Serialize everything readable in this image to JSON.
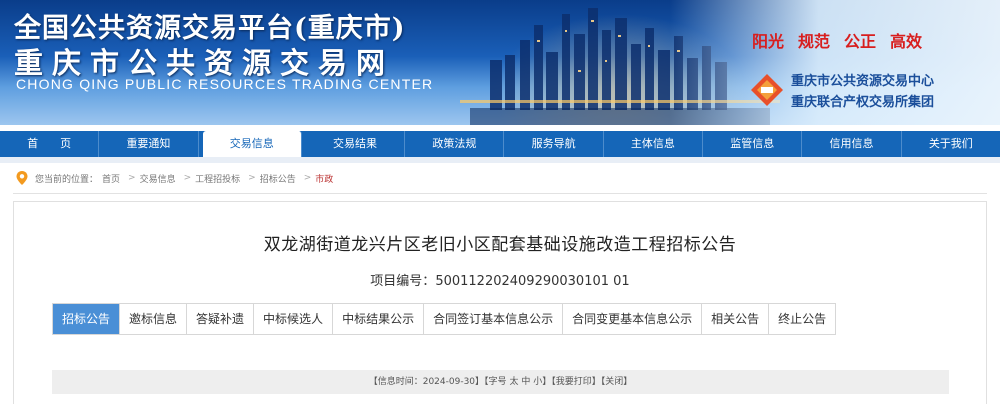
{
  "header": {
    "title_main": "全国公共资源交易平台(重庆市)",
    "title_sub": "重庆市公共资源交易网",
    "title_en": "CHONG QING PUBLIC RESOURCES TRADING CENTER",
    "slogans": [
      "阳光",
      "规范",
      "公正",
      "高效"
    ],
    "org_line1": "重庆市公共资源交易中心",
    "org_line2": "重庆联合产权交易所集团"
  },
  "nav": {
    "items": [
      "首　　页",
      "重要通知",
      "交易信息",
      "交易结果",
      "政策法规",
      "服务导航",
      "主体信息",
      "监管信息",
      "信用信息",
      "关于我们"
    ],
    "active_index": 2
  },
  "breadcrumb": {
    "prefix": "您当前的位置：",
    "items": [
      "首页",
      "交易信息",
      "工程招投标",
      "招标公告",
      "市政"
    ]
  },
  "document": {
    "title": "双龙湖街道龙兴片区老旧小区配套基础设施改造工程招标公告",
    "project_no_label": "项目编号：",
    "project_no": "500112202409290030101 01"
  },
  "tabs": {
    "items": [
      "招标公告",
      "邀标信息",
      "答疑补遗",
      "中标候选人",
      "中标结果公示",
      "合同签订基本信息公示",
      "合同变更基本信息公示",
      "相关公告",
      "终止公告"
    ],
    "active_index": 0
  },
  "info_bar": {
    "time_label": "【信息时间：",
    "time_value": "2024-09-30",
    "font_label": "】【字号",
    "font_large": "太",
    "font_medium": "中",
    "font_small": "小",
    "print_label": "】【我要打印】",
    "close_label": "【关闭】"
  },
  "colors": {
    "nav_bg": "#1566b8",
    "tab_active": "#4a8fd6",
    "slogan": "#d81e1e",
    "org_text": "#1b4f9b"
  }
}
